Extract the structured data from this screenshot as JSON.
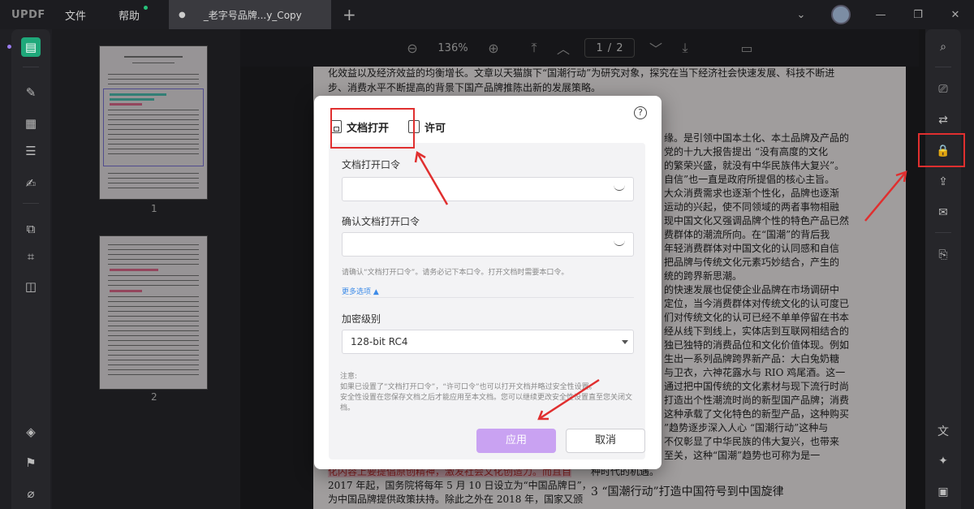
{
  "titlebar": {
    "logo": "UPDF",
    "menu": [
      "文件",
      "帮助"
    ],
    "tab_title": "_老字号品牌...y_Copy",
    "add_tab": "+"
  },
  "toolbar": {
    "zoom": "136%",
    "page_current": "1",
    "page_sep": "/",
    "page_total": "2"
  },
  "thumbnails": {
    "page_numbers": [
      "1",
      "2"
    ]
  },
  "document": {
    "lines": [
      "化效益以及经济效益的均衡增长。文章以天猫旗下“国潮行动”为研究对象，探究在当下经济社会快速发展、科技不断进",
      "步、消费水平不断提高的背景下国产品牌推陈出新的发展策略。",
      "缘。是引领中国本土化、本土品牌及产品的",
      "党的十九大报告提出  “没有高度的文化",
      "的繁荣兴盛，就没有中华民族伟大复兴”。",
      "自信”也一直是政府所提倡的核心主旨。",
      "大众消费需求也逐渐个性化，品牌也逐渐",
      "运动的兴起，使不同领域的两者事物相融",
      "现中国文化又强调品牌个性的特色产品已然",
      "费群体的潮流所向。在“国潮”的背后我",
      "年轻消费群体对中国文化的认同感和自信",
      "把品牌与传统文化元素巧妙结合，产生的",
      "统的跨界新思潮。",
      "的快速发展也促使企业品牌在市场调研中",
      "定位，当今消费群体对传统文化的认可度已",
      "们对传统文化的认可已经不单单停留在书本",
      "经从线下到线上，实体店到互联网相结合的",
      "独已独特的消费品位和文化价值体现。例如",
      "生出一系列品牌跨界新产品：大白兔奶糖",
      "与卫衣，六神花露水与 RIO 鸡尾酒。这一",
      "通过把中国传统的文化素材与现下流行时尚",
      "打造出个性潮流时尚的新型国产品牌；消费",
      "这种承载了文化特色的新型产品，这种购买",
      "”趋势逐步深入人心 “国潮行动”这种与",
      "不仅彰显了中华民族的伟大复兴，也带来",
      "至关，这种“国潮”趋势也可称为是一",
      "种时代的机遇。",
      "化内容上要提倡原创精神，激发社会文化创造力。而且自",
      "2017 年起，国务院将每年 5 月 10 日设立为“中国品牌日”，",
      "为中国品牌提供政策扶持。除此之外在 2018 年，国家又颁",
      "3   “国潮行动”打造中国符号到中国旋律"
    ]
  },
  "dialog": {
    "tab_open": "文档打开",
    "tab_permission": "许可",
    "help": "?",
    "open_password_label": "文档打开口令",
    "confirm_password_label": "确认文档打开口令",
    "hint": "请确认“文档打开口令”。请务必记下本口令。打开文档时需要本口令。",
    "more_options": "更多选项",
    "encryption_label": "加密级别",
    "encryption_value": "128-bit RC4",
    "note_title": "注意:",
    "note_line1": "如果已设置了“文档打开口令”，“许可口令”也可以打开文档并略过安全性设置。",
    "note_line2": "安全性设置在您保存文档之后才能应用至本文档。您可以继续更改安全性设置直至您关闭文",
    "note_line3": "档。",
    "apply": "应用",
    "cancel": "取消"
  },
  "colors": {
    "accent_green": "#1fa87a",
    "apply_purple": "#c9a2f2",
    "annotation_red": "#e02f2f",
    "link_blue": "#3d8be8"
  }
}
